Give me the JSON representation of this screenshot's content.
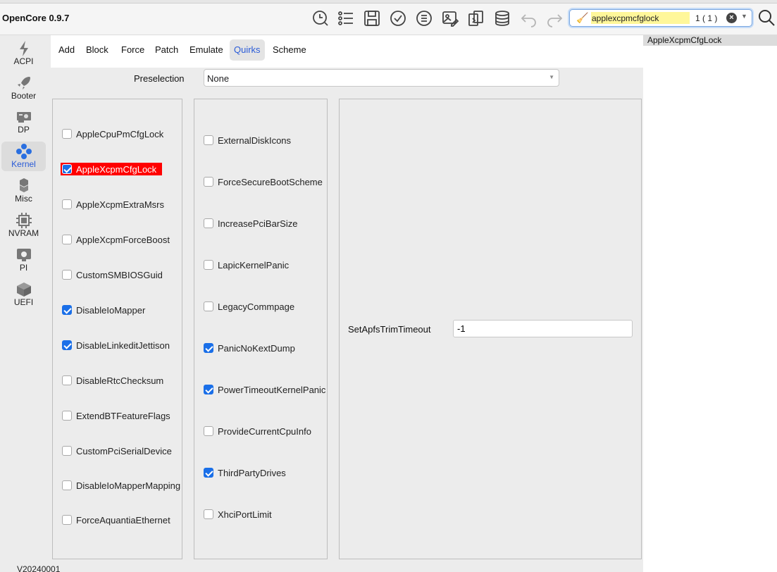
{
  "app": {
    "title": "OpenCore 0.9.7",
    "version": "V20240001"
  },
  "toolbar": {
    "icons": [
      "clock-icon",
      "list-icon",
      "save-icon",
      "check-circle-icon",
      "list-gear-icon",
      "image-edit-icon",
      "compare-icon",
      "database-icon",
      "undo-icon",
      "redo-icon"
    ],
    "search": {
      "value": "applexcpmcfglock",
      "match_count": "1 ( 1 )"
    }
  },
  "nav": {
    "items": [
      {
        "label": "ACPI",
        "icon": "lightning-icon"
      },
      {
        "label": "Booter",
        "icon": "rocket-icon"
      },
      {
        "label": "DP",
        "icon": "gpu-icon"
      },
      {
        "label": "Kernel",
        "icon": "kernel-icon",
        "active": true
      },
      {
        "label": "Misc",
        "icon": "cubes-icon"
      },
      {
        "label": "NVRAM",
        "icon": "chip-icon"
      },
      {
        "label": "PI",
        "icon": "apple-icon"
      },
      {
        "label": "UEFI",
        "icon": "box-icon"
      }
    ]
  },
  "tabs": [
    {
      "label": "Add"
    },
    {
      "label": "Block"
    },
    {
      "label": "Force"
    },
    {
      "label": "Patch"
    },
    {
      "label": "Emulate"
    },
    {
      "label": "Quirks",
      "active": true
    },
    {
      "label": "Scheme"
    }
  ],
  "preselection": {
    "label": "Preselection",
    "value": "None"
  },
  "quirks_col1": [
    {
      "label": "AppleCpuPmCfgLock",
      "checked": false
    },
    {
      "label": "AppleXcpmCfgLock",
      "checked": true,
      "highlighted": true
    },
    {
      "label": "AppleXcpmExtraMsrs",
      "checked": false
    },
    {
      "label": "AppleXcpmForceBoost",
      "checked": false
    },
    {
      "label": "CustomSMBIOSGuid",
      "checked": false
    },
    {
      "label": "DisableIoMapper",
      "checked": true
    },
    {
      "label": "DisableLinkeditJettison",
      "checked": true
    },
    {
      "label": "DisableRtcChecksum",
      "checked": false
    },
    {
      "label": "ExtendBTFeatureFlags",
      "checked": false
    },
    {
      "label": "CustomPciSerialDevice",
      "checked": false
    },
    {
      "label": "DisableIoMapperMapping",
      "checked": false
    },
    {
      "label": "ForceAquantiaEthernet",
      "checked": false
    }
  ],
  "quirks_col2": [
    {
      "label": "ExternalDiskIcons",
      "checked": false
    },
    {
      "label": "ForceSecureBootScheme",
      "checked": false
    },
    {
      "label": "IncreasePciBarSize",
      "checked": false
    },
    {
      "label": "LapicKernelPanic",
      "checked": false
    },
    {
      "label": "LegacyCommpage",
      "checked": false
    },
    {
      "label": "PanicNoKextDump",
      "checked": true
    },
    {
      "label": "PowerTimeoutKernelPanic",
      "checked": true
    },
    {
      "label": "ProvideCurrentCpuInfo",
      "checked": false
    },
    {
      "label": "ThirdPartyDrives",
      "checked": true
    },
    {
      "label": "XhciPortLimit",
      "checked": false
    }
  ],
  "setapfs": {
    "label": "SetApfsTrimTimeout",
    "value": "-1"
  },
  "results": [
    {
      "label": "AppleXcpmCfgLock"
    }
  ]
}
